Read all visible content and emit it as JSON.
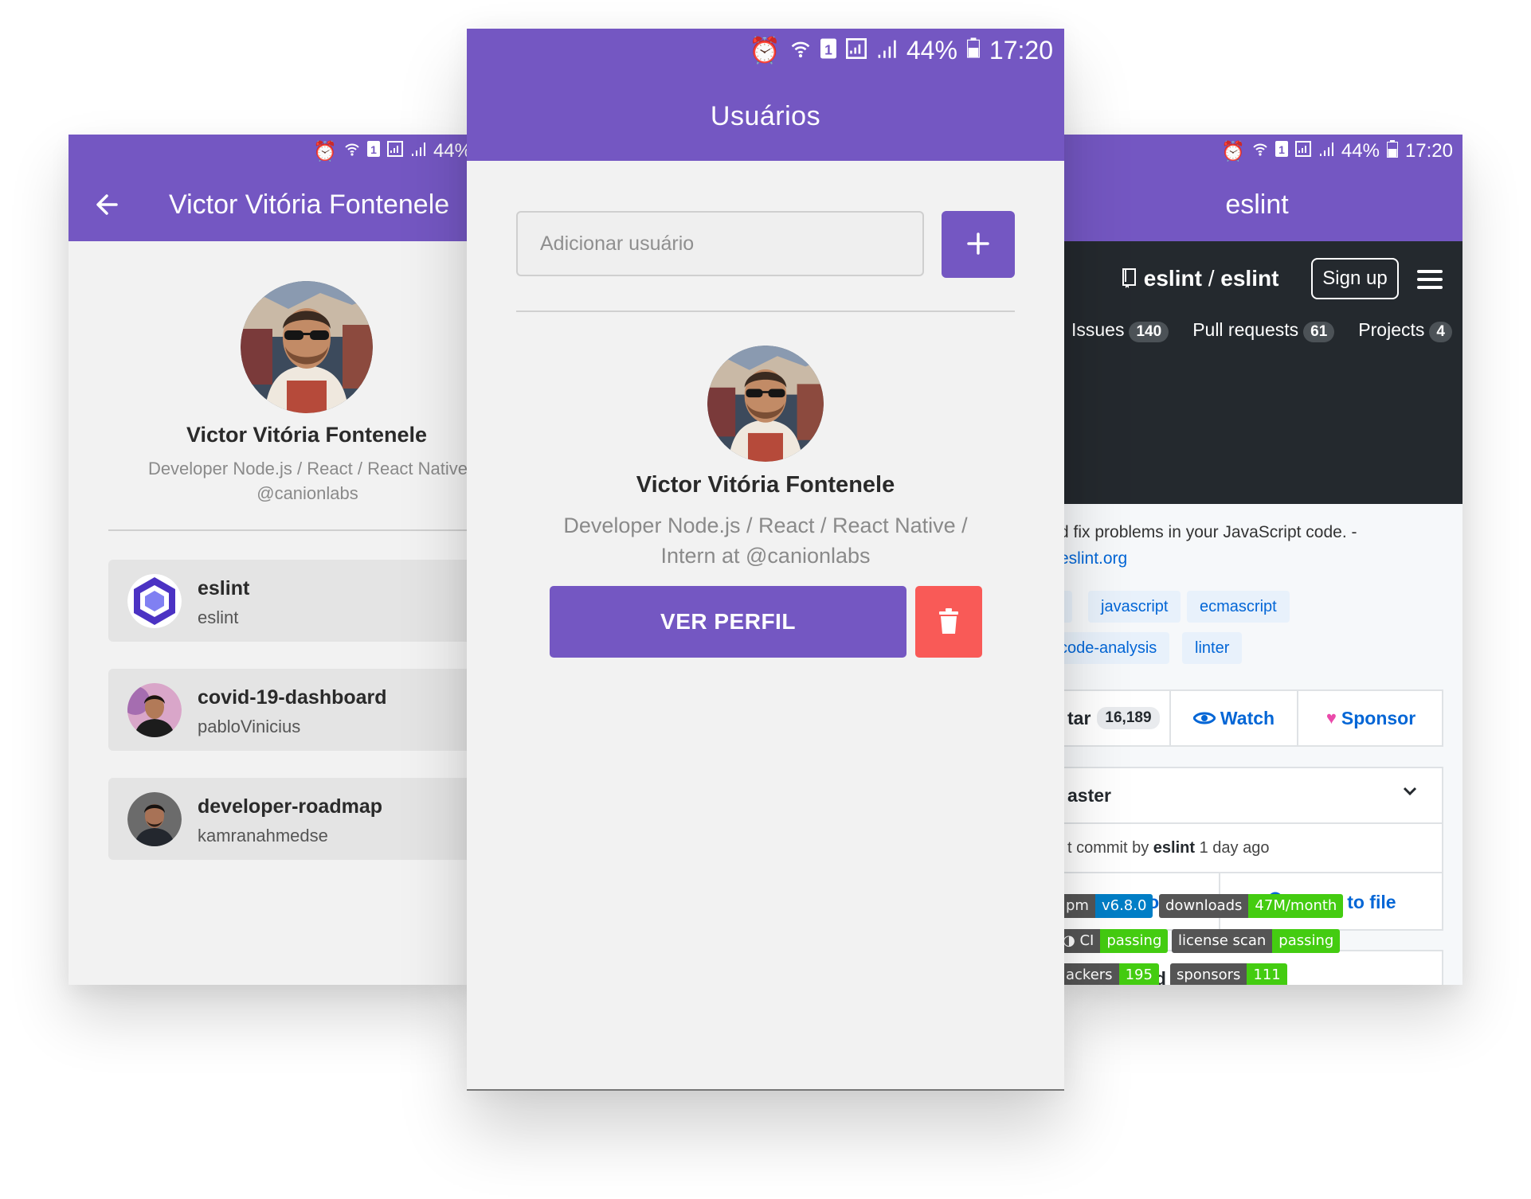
{
  "colors": {
    "primary": "#7457c2",
    "danger": "#f95a57",
    "github_dark": "#24292e",
    "link": "#0366d6"
  },
  "status": {
    "battery": "44%",
    "time": "17:20",
    "sim": "1"
  },
  "left": {
    "title": "Victor Vitória Fontenele",
    "name": "Victor Vitória Fontenele",
    "bio_line1": "Developer Node.js / React / React Native / Inte",
    "bio_line2": "@canionlabs",
    "repos": [
      {
        "name": "eslint",
        "owner": "eslint",
        "icon": "eslint-logo-icon"
      },
      {
        "name": "covid-19-dashboard",
        "owner": "pabloVinicius",
        "icon": "user-avatar"
      },
      {
        "name": "developer-roadmap",
        "owner": "kamranahmedse",
        "icon": "user-avatar"
      }
    ]
  },
  "center": {
    "title": "Usuários",
    "input_placeholder": "Adicionar usuário",
    "add_icon": "plus-icon",
    "name": "Victor Vitória Fontenele",
    "bio_line1": "Developer Node.js / React / React Native /",
    "bio_line2": "Intern at @canionlabs",
    "view_profile_label": "VER PERFIL",
    "delete_icon": "trash-icon"
  },
  "right": {
    "title": "eslint",
    "repo_owner": "eslint",
    "repo_sep": " / ",
    "repo_name": "eslint",
    "signup_label": "Sign up",
    "tabs": [
      {
        "label": "Issues",
        "count": "140"
      },
      {
        "label": "Pull requests",
        "count": "61"
      },
      {
        "label": "Projects",
        "count": "4"
      }
    ],
    "description": "d fix problems in your JavaScript code. -",
    "website": "eslint.org",
    "topics": [
      "javascript",
      "ecmascript",
      "code-analysis",
      "linter"
    ],
    "star_label": "tar",
    "star_count": "16,189",
    "watch_label": "Watch",
    "sponsor_label": "Sponsor",
    "branch": "aster",
    "commit_prefix": "t commit by ",
    "commit_author": "eslint",
    "commit_time": " 1 day ago",
    "view_code_label": "View code",
    "jump_label": "Jump to file",
    "readme": "EADME.md",
    "badges": [
      {
        "left": "pm",
        "right": "v6.8.0"
      },
      {
        "left": "downloads",
        "right": "47M/month"
      },
      {
        "left": "CI",
        "right": "passing"
      },
      {
        "left": "license scan",
        "right": "passing"
      },
      {
        "left": "ackers",
        "right": "195"
      },
      {
        "left": "sponsors",
        "right": "111"
      }
    ]
  }
}
